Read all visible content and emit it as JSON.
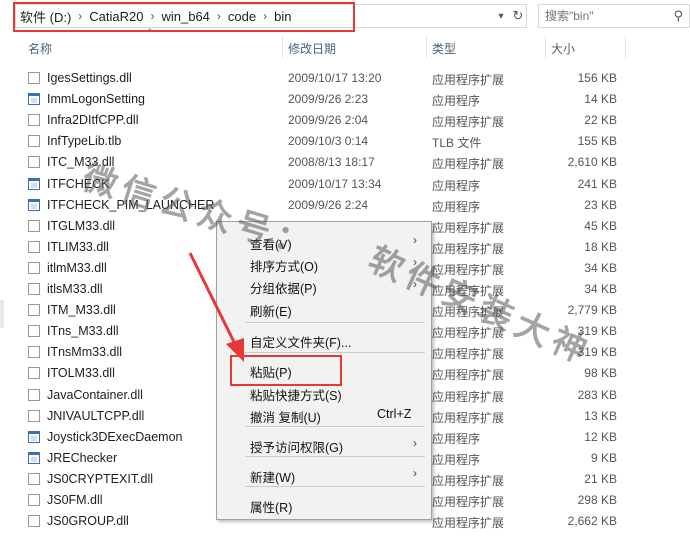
{
  "address": {
    "crumbs": [
      "软件 (D:)",
      "CatiaR20",
      "win_b64",
      "code",
      "bin"
    ],
    "separator": "›",
    "dropdown_icon": "chevron-down-icon",
    "refresh_icon": "refresh-icon"
  },
  "search": {
    "placeholder": "搜索\"bin\"",
    "icon": "search-icon"
  },
  "columns": {
    "name": "名称",
    "date": "修改日期",
    "type": "类型",
    "size": "大小"
  },
  "files": [
    {
      "name": "IgesSettings.dll",
      "date": "2009/10/17 13:20",
      "type": "应用程序扩展",
      "size": "156 KB",
      "icon": "dll"
    },
    {
      "name": "ImmLogonSetting",
      "date": "2009/9/26 2:23",
      "type": "应用程序",
      "size": "14 KB",
      "icon": "app"
    },
    {
      "name": "Infra2DItfCPP.dll",
      "date": "2009/9/26 2:04",
      "type": "应用程序扩展",
      "size": "22 KB",
      "icon": "dll"
    },
    {
      "name": "InfTypeLib.tlb",
      "date": "2009/10/3 0:14",
      "type": "TLB 文件",
      "size": "155 KB",
      "icon": "tlb"
    },
    {
      "name": "ITC_M33.dll",
      "date": "2008/8/13 18:17",
      "type": "应用程序扩展",
      "size": "2,610 KB",
      "icon": "dll"
    },
    {
      "name": "ITFCHECK",
      "date": "2009/10/17 13:34",
      "type": "应用程序",
      "size": "241 KB",
      "icon": "app"
    },
    {
      "name": "ITFCHECK_PIM_LAUNCHER",
      "date": "2009/9/26 2:24",
      "type": "应用程序",
      "size": "23 KB",
      "icon": "app"
    },
    {
      "name": "ITGLM33.dll",
      "date": "",
      "type": "应用程序扩展",
      "size": "45 KB",
      "icon": "dll"
    },
    {
      "name": "ITLIM33.dll",
      "date": "",
      "type": "应用程序扩展",
      "size": "18 KB",
      "icon": "dll"
    },
    {
      "name": "itlmM33.dll",
      "date": "",
      "type": "应用程序扩展",
      "size": "34 KB",
      "icon": "dll"
    },
    {
      "name": "itlsM33.dll",
      "date": "",
      "type": "应用程序扩展",
      "size": "34 KB",
      "icon": "dll"
    },
    {
      "name": "ITM_M33.dll",
      "date": "",
      "type": "应用程序扩展",
      "size": "2,779 KB",
      "icon": "dll"
    },
    {
      "name": "ITns_M33.dll",
      "date": "",
      "type": "应用程序扩展",
      "size": "319 KB",
      "icon": "dll"
    },
    {
      "name": "ITnsMm33.dll",
      "date": "",
      "type": "应用程序扩展",
      "size": "319 KB",
      "icon": "dll"
    },
    {
      "name": "ITOLM33.dll",
      "date": "",
      "type": "应用程序扩展",
      "size": "98 KB",
      "icon": "dll"
    },
    {
      "name": "JavaContainer.dll",
      "date": "",
      "type": "应用程序扩展",
      "size": "283 KB",
      "icon": "dll"
    },
    {
      "name": "JNIVAULTCPP.dll",
      "date": "",
      "type": "应用程序扩展",
      "size": "13 KB",
      "icon": "dll"
    },
    {
      "name": "Joystick3DExecDaemon",
      "date": "",
      "type": "应用程序",
      "size": "12 KB",
      "icon": "app"
    },
    {
      "name": "JREChecker",
      "date": "",
      "type": "应用程序",
      "size": "9 KB",
      "icon": "app"
    },
    {
      "name": "JS0CRYPTEXIT.dll",
      "date": "",
      "type": "应用程序扩展",
      "size": "21 KB",
      "icon": "dll"
    },
    {
      "name": "JS0FM.dll",
      "date": "",
      "type": "应用程序扩展",
      "size": "298 KB",
      "icon": "dll"
    },
    {
      "name": "JS0GROUP.dll",
      "date": "",
      "type": "应用程序扩展",
      "size": "2,662 KB",
      "icon": "dll"
    }
  ],
  "context_menu": {
    "items": [
      {
        "label": "查看(V)",
        "submenu": true
      },
      {
        "label": "排序方式(O)",
        "submenu": true
      },
      {
        "label": "分组依据(P)",
        "submenu": true
      },
      {
        "label": "刷新(E)",
        "submenu": false
      },
      {
        "label": "自定义文件夹(F)...",
        "submenu": false
      },
      {
        "label": "粘贴(P)",
        "submenu": false
      },
      {
        "label": "粘贴快捷方式(S)",
        "submenu": false
      },
      {
        "label": "撤消 复制(U)",
        "shortcut": "Ctrl+Z",
        "submenu": false
      },
      {
        "label": "授予访问权限(G)",
        "submenu": true
      },
      {
        "label": "新建(W)",
        "submenu": true
      },
      {
        "label": "属性(R)",
        "submenu": false
      }
    ],
    "submenu_icon": "chevron-right-icon"
  },
  "watermark": {
    "line1": "微信公众号：",
    "line2": "软件安装大神"
  },
  "colors": {
    "highlight": "#e53935",
    "header_text": "#4c607a",
    "menu_bg": "#f2f2f2"
  }
}
